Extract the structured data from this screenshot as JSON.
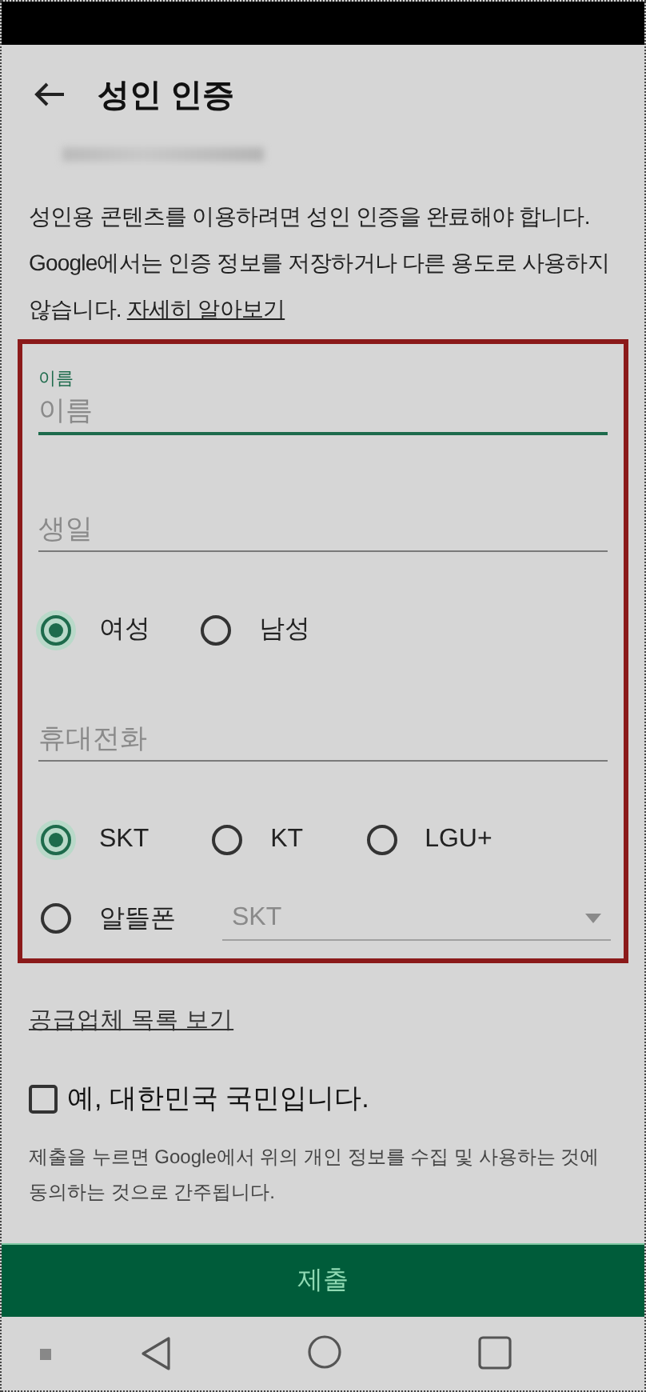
{
  "title": "성인 인증",
  "intro": {
    "text": "성인용 콘텐츠를 이용하려면 성인 인증을 완료해야 합니다. Google에서는 인증 정보를 저장하거나 다른 용도로 사용하지 않습니다. ",
    "link": "자세히 알아보기"
  },
  "form": {
    "name_field": {
      "label": "이름",
      "placeholder": "이름",
      "focused": true
    },
    "birthday_field": {
      "placeholder": "생일",
      "focused": false
    },
    "gender": [
      {
        "label": "여성",
        "selected": true
      },
      {
        "label": "남성",
        "selected": false
      }
    ],
    "phone_field": {
      "placeholder": "휴대전화",
      "focused": false
    },
    "carriers": [
      {
        "label": "SKT",
        "selected": true
      },
      {
        "label": "KT",
        "selected": false
      },
      {
        "label": "LGU+",
        "selected": false
      }
    ],
    "mvno": {
      "label": "알뜰폰",
      "selected": false,
      "dropdown": {
        "value": "SKT",
        "disabled": true
      }
    }
  },
  "provider_link": "공급업체 목록 보기",
  "citizen_checkbox": {
    "label": "예, 대한민국 국민입니다.",
    "checked": false
  },
  "notice": "제출을 누르면 Google에서 위의 개인 정보를 수집 및 사용하는 것에 동의하는 것으로 간주됩니다.",
  "submit_button": "제출"
}
